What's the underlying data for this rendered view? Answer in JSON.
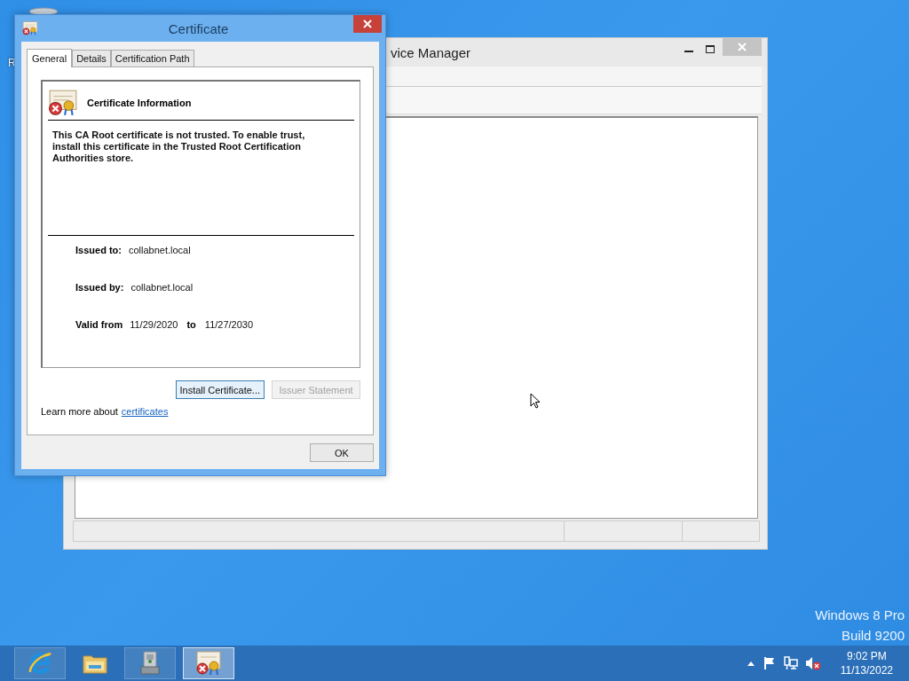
{
  "desktop": {
    "icons": [
      {
        "label": "R"
      }
    ],
    "edition_lines": [
      "Windows 8 Pro",
      "Build 9200"
    ]
  },
  "background_window": {
    "title": "vice Manager"
  },
  "dialog": {
    "title": "Certificate",
    "tabs": [
      {
        "label": "General",
        "selected": true
      },
      {
        "label": "Details",
        "selected": false
      },
      {
        "label": "Certification Path",
        "selected": false
      }
    ],
    "info_heading": "Certificate Information",
    "message": "This CA Root certificate is not trusted. To enable trust, install this certificate in the Trusted Root Certification Authorities store.",
    "fields": [
      {
        "label": "Issued to:",
        "value": "collabnet.local"
      },
      {
        "label": "Issued by:",
        "value": "collabnet.local"
      }
    ],
    "validity": {
      "label": "Valid from",
      "from": "11/29/2020",
      "to_label": "to",
      "to": "11/27/2030"
    },
    "buttons": [
      {
        "label": "Install Certificate...",
        "disabled": false
      },
      {
        "label": "Issuer Statement",
        "disabled": true
      }
    ],
    "learn_more": {
      "text": "Learn more about",
      "link": "certificates"
    },
    "ok_button": "OK"
  },
  "taskbar": {
    "items": [
      {
        "kind": "browser",
        "selected": false
      },
      {
        "kind": "folder",
        "selected": false
      },
      {
        "kind": "devices",
        "selected": false
      },
      {
        "kind": "certificate",
        "selected": true
      }
    ],
    "tray": {
      "time": "9:02 PM",
      "date": "11/13/2022"
    }
  }
}
